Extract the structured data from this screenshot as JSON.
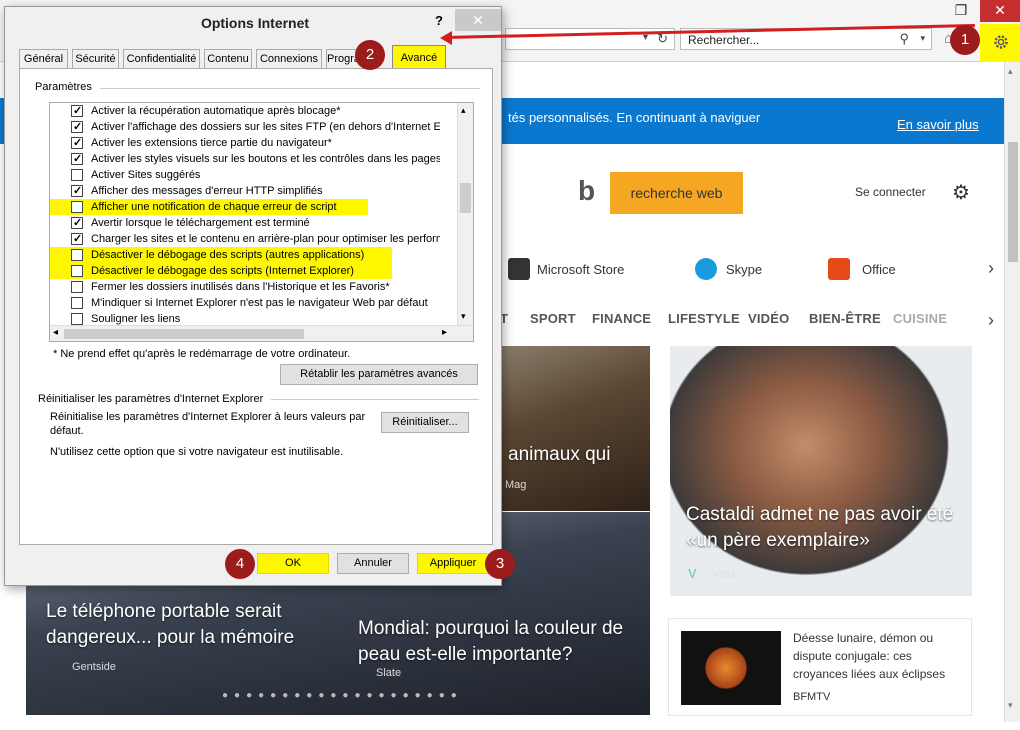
{
  "browser": {
    "window_controls": {
      "restore": "❐",
      "close": "✕"
    },
    "search_placeholder": "Rechercher...",
    "address_dropdown": "▾",
    "refresh_icon": "↻",
    "search_icon": "⚲",
    "search_dropdown": "▾",
    "home_icon": "⌂",
    "highlight_color": "#fff700"
  },
  "page": {
    "banner_text": "tés personnalisés. En continuant à naviguer",
    "banner_link": "En savoir plus",
    "bing_logo": "b",
    "search_button": "recherche web",
    "signin": "Se connecter",
    "settings_icon": "⚙",
    "quicklinks": [
      "Microsoft Store",
      "Skype",
      "Office"
    ],
    "categories": [
      "T",
      "SPORT",
      "FINANCE",
      "LIFESTYLE",
      "VIDÉO",
      "BIEN-ÊTRE",
      "CUISINE"
    ],
    "chevron": "›",
    "articles": {
      "a1_caption": "animaux qui",
      "a1_source": "Mag",
      "a2_caption": "Castaldi admet ne pas avoir été «un père exemplaire»",
      "a2_source": "Voici",
      "a2_logo": "V",
      "a3_caption": "Le téléphone portable serait dangereux... pour la mémoire",
      "a3_source": "Gentside",
      "a4_caption": "Mondial: pourquoi la couleur de peau est-elle importante?",
      "a4_source": "Slate",
      "a5_title": "Déesse lunaire, démon ou dispute conjugale: ces croyances liées aux éclipses",
      "a5_source": "BFMTV"
    },
    "carousel_dots": "●●●●●●●●●●●●●●●●●●●●"
  },
  "dialog": {
    "title": "Options Internet",
    "help": "?",
    "close": "✕",
    "tabs": [
      "Général",
      "Sécurité",
      "Confidentialité",
      "Contenu",
      "Connexions",
      "Programmes",
      "Avancé"
    ],
    "group_title": "Paramètres",
    "settings": [
      {
        "label": "Activer la récupération automatique après blocage*",
        "checked": true,
        "highlight": false
      },
      {
        "label": "Activer l'affichage des dossiers sur les sites FTP (en dehors d'Internet Explo",
        "checked": true,
        "highlight": false
      },
      {
        "label": "Activer les extensions tierce partie du navigateur*",
        "checked": true,
        "highlight": false
      },
      {
        "label": "Activer les styles visuels sur les boutons et les contrôles dans les pages We",
        "checked": true,
        "highlight": false
      },
      {
        "label": "Activer Sites suggérés",
        "checked": false,
        "highlight": false
      },
      {
        "label": "Afficher des messages d'erreur HTTP simplifiés",
        "checked": true,
        "highlight": false
      },
      {
        "label": "Afficher une notification de chaque erreur de script",
        "checked": false,
        "highlight": true
      },
      {
        "label": "Avertir lorsque le téléchargement est terminé",
        "checked": true,
        "highlight": false
      },
      {
        "label": "Charger les sites et le contenu en arrière-plan pour optimiser les performanc",
        "checked": true,
        "highlight": false
      },
      {
        "label": "Désactiver le débogage des scripts (autres applications)",
        "checked": false,
        "highlight": true
      },
      {
        "label": "Désactiver le débogage des scripts (Internet Explorer)",
        "checked": false,
        "highlight": true
      },
      {
        "label": "Fermer les dossiers inutilisés dans l'Historique et les Favoris*",
        "checked": false,
        "highlight": false
      },
      {
        "label": "M'indiquer si Internet Explorer n'est pas le navigateur Web par défaut",
        "checked": false,
        "highlight": false
      },
      {
        "label": "Souligner les liens",
        "checked": false,
        "highlight": false
      }
    ],
    "note": "* Ne prend effet qu'après le redémarrage de votre ordinateur.",
    "restore_button": "Rétablir les paramètres avancés",
    "reset_title": "Réinitialiser les paramètres d'Internet Explorer",
    "reset_desc": "Réinitialise les paramètres d'Internet Explorer à leurs valeurs par défaut.",
    "reset_button": "Réinitialiser...",
    "reset_warning": "N'utilisez cette option que si votre navigateur est inutilisable.",
    "ok": "OK",
    "cancel": "Annuler",
    "apply": "Appliquer",
    "scroll_up": "▴",
    "scroll_down": "▾",
    "scroll_left": "◂",
    "scroll_right": "▸"
  },
  "annotations": {
    "badge_1": "1",
    "badge_2": "2",
    "badge_3": "3",
    "badge_4": "4",
    "badge_color": "#9c1b1b",
    "arrow_color": "#d21e1e"
  }
}
